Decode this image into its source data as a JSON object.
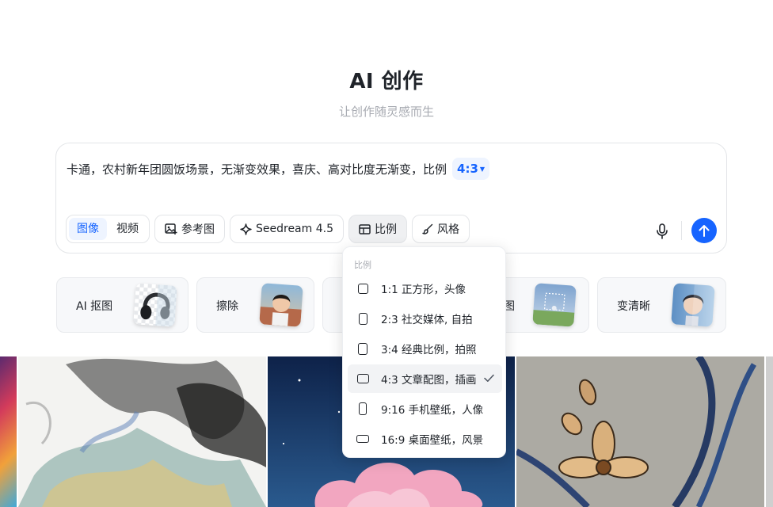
{
  "header": {
    "title": "AI 创作",
    "subtitle": "让创作随灵感而生"
  },
  "composer": {
    "prompt_text": "卡通，农村新年团圆饭场景，无渐变效果，喜庆、高对比度无渐变，比例",
    "ratio_chip": "4:3",
    "mode_tabs": [
      "图像",
      "视频"
    ],
    "active_mode": "图像",
    "reference_label": "参考图",
    "model_label": "Seedream 4.5",
    "ratio_label": "比例",
    "style_label": "风格"
  },
  "ratio_menu": {
    "title": "比例",
    "items": [
      {
        "label": "1:1 正方形，头像",
        "selected": false
      },
      {
        "label": "2:3 社交媒体, 自拍",
        "selected": false
      },
      {
        "label": "3:4 经典比例，拍照",
        "selected": false
      },
      {
        "label": "4:3 文章配图，插画",
        "selected": true
      },
      {
        "label": "9:16 手机壁纸，人像",
        "selected": false
      },
      {
        "label": "16:9 桌面壁纸，风景",
        "selected": false
      }
    ]
  },
  "tools": [
    {
      "label": "AI 抠图"
    },
    {
      "label": "擦除"
    },
    {
      "label": "图"
    },
    {
      "label": "变清晰"
    }
  ],
  "colors": {
    "accent": "#1664ff",
    "accent_bg": "#eef4ff",
    "text": "#1f2329",
    "muted": "#a8abb2",
    "border": "#e3e5e8"
  },
  "icons": [
    "image-icon",
    "sparkle-icon",
    "layout-icon",
    "brush-icon",
    "microphone-icon",
    "arrow-up-icon",
    "check-icon",
    "caret-down-icon"
  ]
}
